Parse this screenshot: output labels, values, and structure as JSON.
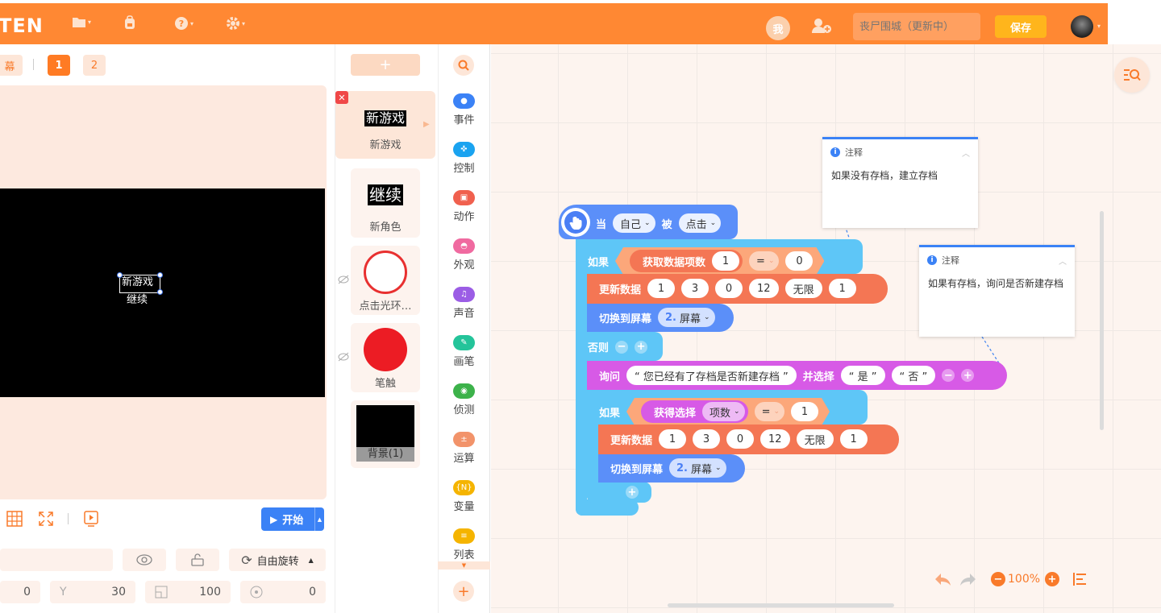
{
  "topbar": {
    "brand": "TEN",
    "me": "我",
    "project_placeholder": "丧尸围城（更新中）",
    "save": "保存"
  },
  "stage": {
    "screen_tab_partial": "幕",
    "screen_tabs": [
      "1",
      "2"
    ],
    "sprite_texts": [
      "新游戏",
      "继续"
    ],
    "start": "开始",
    "rotation_mode": "自由旋转",
    "props": {
      "x": "0",
      "y_label": "Y",
      "y": "30",
      "size": "100",
      "direction": "0"
    }
  },
  "sprites": {
    "add": "+",
    "items": [
      {
        "name": "新游戏",
        "thumb_text": "新游戏",
        "selected": true
      },
      {
        "name": "新角色",
        "thumb_text": "继续"
      },
      {
        "name": "点击光环…",
        "thumb": "red-ring",
        "hidden": true
      },
      {
        "name": "笔触",
        "thumb": "red-dot",
        "hidden": true
      },
      {
        "name": "背景(1)",
        "thumb": "black"
      }
    ]
  },
  "categories": [
    {
      "label": "事件",
      "color": "#3b82f6"
    },
    {
      "label": "控制",
      "color": "#1aa3f0"
    },
    {
      "label": "动作",
      "color": "#f0604e"
    },
    {
      "label": "外观",
      "color": "#f06aa0"
    },
    {
      "label": "声音",
      "color": "#9b5de5"
    },
    {
      "label": "画笔",
      "color": "#24c49a"
    },
    {
      "label": "侦测",
      "color": "#3cb24a"
    },
    {
      "label": "运算",
      "color": "#f2936a"
    },
    {
      "label": "变量",
      "color": "#f5b400"
    },
    {
      "label": "列表",
      "color": "#f5b400"
    }
  ],
  "blocks": {
    "hat": {
      "when": "当",
      "target": "自己",
      "by": "被",
      "event": "点击"
    },
    "if1": {
      "label": "如果",
      "reporter": "获取数据项数",
      "arg": "1",
      "op": "=",
      "value": "0"
    },
    "update1": {
      "label": "更新数据",
      "args": [
        "1",
        "3",
        "0",
        "12",
        "无限",
        "1"
      ]
    },
    "switch1": {
      "label": "切换到屏幕",
      "num": "2.",
      "screen": "屏幕"
    },
    "else": "否则",
    "ask": {
      "label": "询问",
      "question": "“ 您已经有了存档是否新建存档 ”",
      "choose": "并选择",
      "opt1": "“ 是 ”",
      "opt2": "“ 否 ”"
    },
    "if2": {
      "label": "如果",
      "reporter": "获得选择",
      "sub": "项数",
      "op": "=",
      "value": "1"
    },
    "update2": {
      "label": "更新数据",
      "args": [
        "1",
        "3",
        "0",
        "12",
        "无限",
        "1"
      ]
    },
    "switch2": {
      "label": "切换到屏幕",
      "num": "2.",
      "screen": "屏幕"
    }
  },
  "notes": [
    {
      "title": "注释",
      "text": "如果没有存档，建立存档"
    },
    {
      "title": "注释",
      "text": "如果有存档，询问是否新建存档"
    }
  ],
  "zoom": "100%"
}
